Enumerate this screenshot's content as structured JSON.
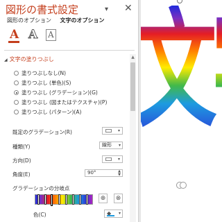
{
  "pane": {
    "title": "図形の書式設定",
    "dropdown_icon": "chevron-down-icon",
    "close_icon": "close-icon",
    "tabs": [
      {
        "label": "図形のオプション",
        "active": false
      },
      {
        "label": "文字のオプション",
        "active": true
      }
    ],
    "icon_buttons": [
      "text-fill-icon",
      "text-effects-icon",
      "textbox-icon"
    ],
    "section_title": "文字の塗りつぶし",
    "fill_options": [
      {
        "label": "塗りつぶしなし(N)",
        "selected": false
      },
      {
        "label": "塗りつぶし (単色)(S)",
        "selected": false
      },
      {
        "label": "塗りつぶし (グラデーション)(G)",
        "selected": true
      },
      {
        "label": "塗りつぶし (図またはテクスチャ)(P)",
        "selected": false
      },
      {
        "label": "塗りつぶし (パターン)(A)",
        "selected": false
      }
    ],
    "preset_gradient_label": "既定のグラデーション(R)",
    "type_label": "種類(Y)",
    "type_value": "線形",
    "direction_label": "方向(D)",
    "angle_label": "角度(E)",
    "angle_value": "90°",
    "stops_label": "グラデーションの分岐点",
    "color_label": "色(C)",
    "accent_color": "#c43e1c"
  },
  "canvas": {
    "text": "文字"
  }
}
